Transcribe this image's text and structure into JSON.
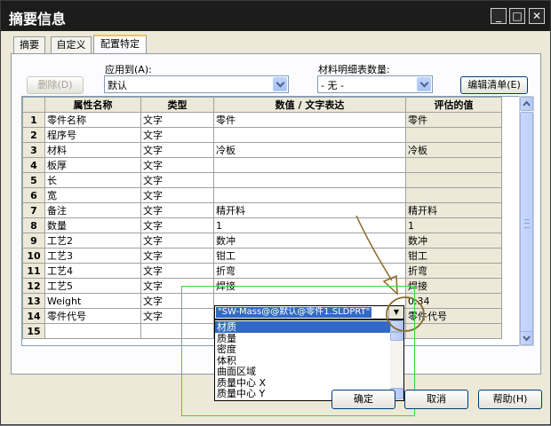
{
  "window": {
    "title": "摘要信息",
    "min": "_",
    "max": "□",
    "close": "✕"
  },
  "tabs": [
    "摘要",
    "自定义",
    "配置特定"
  ],
  "apply_to": {
    "label": "应用到(A):",
    "value": "默认"
  },
  "bom_qty": {
    "label": "材料明细表数量:",
    "value": "- 无 -"
  },
  "buttons": {
    "delete": "删除(D)",
    "edit_list": "编辑清单(E)",
    "ok": "确定",
    "cancel": "取消",
    "help": "帮助(H)"
  },
  "table": {
    "headers": [
      "",
      "属性名称",
      "类型",
      "数值 / 文字表达",
      "评估的值"
    ],
    "rows": [
      {
        "n": "1",
        "name": "零件名称",
        "type": "文字",
        "value": "零件",
        "eval": "零件"
      },
      {
        "n": "2",
        "name": "程序号",
        "type": "文字",
        "value": "",
        "eval": ""
      },
      {
        "n": "3",
        "name": "材料",
        "type": "文字",
        "value": "冷板",
        "eval": "冷板"
      },
      {
        "n": "4",
        "name": "板厚",
        "type": "文字",
        "value": "",
        "eval": ""
      },
      {
        "n": "5",
        "name": "长",
        "type": "文字",
        "value": "",
        "eval": ""
      },
      {
        "n": "6",
        "name": "宽",
        "type": "文字",
        "value": "",
        "eval": ""
      },
      {
        "n": "7",
        "name": "备注",
        "type": "文字",
        "value": "精开料",
        "eval": "精开料"
      },
      {
        "n": "8",
        "name": "数量",
        "type": "文字",
        "value": "1",
        "eval": "1"
      },
      {
        "n": "9",
        "name": "工艺2",
        "type": "文字",
        "value": "数冲",
        "eval": "数冲"
      },
      {
        "n": "10",
        "name": "工艺3",
        "type": "文字",
        "value": "钳工",
        "eval": "钳工"
      },
      {
        "n": "11",
        "name": "工艺4",
        "type": "文字",
        "value": "折弯",
        "eval": "折弯"
      },
      {
        "n": "12",
        "name": "工艺5",
        "type": "文字",
        "value": "焊接",
        "eval": "焊接"
      },
      {
        "n": "13",
        "name": "Weight",
        "type": "文字",
        "value": "",
        "eval": "0.34"
      },
      {
        "n": "14",
        "name": "零件代号",
        "type": "文字",
        "value": "",
        "eval": "零件代号"
      },
      {
        "n": "15",
        "name": "",
        "type": "",
        "value": "",
        "eval": ""
      }
    ]
  },
  "editor": {
    "value": "\"SW-Mass@@默认@零件1.SLDPRT\"",
    "dropdown_arrow": "▼"
  },
  "dropdown": {
    "items": [
      "材质",
      "质量",
      "密度",
      "体积",
      "曲面区域",
      "质量中心 X",
      "质量中心 Y"
    ],
    "selected_index": 0
  },
  "colors": {
    "selection": "#316ac5",
    "annotation": "#8a6a2a",
    "highlight_box": "#3ed43e"
  }
}
